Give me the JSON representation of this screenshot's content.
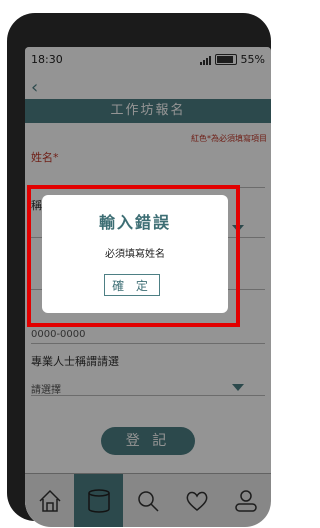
{
  "status": {
    "time": "18:30",
    "battery": "55%"
  },
  "header": {
    "back_icon": "chevron-left-icon",
    "title": "工作坊報名"
  },
  "form": {
    "required_note": "紅色*為必須填寫項目",
    "name_label": "姓名*",
    "title_label": "稱謂",
    "phone_placeholder": "0000-0000",
    "professional_label": "專業人士稱謂請選",
    "professional_value": "請選擇",
    "submit_label": "登 記"
  },
  "dialog": {
    "title": "輸入錯誤",
    "message": "必須填寫姓名",
    "confirm_label": "確 定"
  },
  "nav": {
    "items": [
      {
        "icon": "home-icon"
      },
      {
        "icon": "database-icon"
      },
      {
        "icon": "search-icon"
      },
      {
        "icon": "heart-icon"
      },
      {
        "icon": "user-icon"
      }
    ],
    "active_index": 1
  },
  "colors": {
    "accent": "#4d7f84",
    "error": "#c0392b",
    "highlight": "#e20000"
  }
}
